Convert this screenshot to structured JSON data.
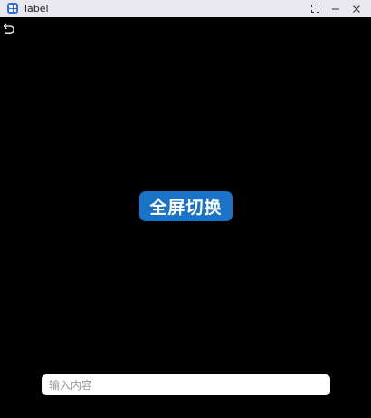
{
  "window": {
    "title": "label",
    "controls": {
      "fullscreen_icon": "fullscreen-icon",
      "minimize_icon": "minimize-icon",
      "close_icon": "close-icon"
    }
  },
  "content": {
    "back_icon": "back-arrow-icon",
    "toggle_button_label": "全屏切换",
    "input": {
      "value": "",
      "placeholder": "输入内容"
    }
  },
  "colors": {
    "titlebar": "#e8e8ee",
    "background": "#000000",
    "accent": "#1a73c6",
    "input_bg": "#ffffff"
  }
}
